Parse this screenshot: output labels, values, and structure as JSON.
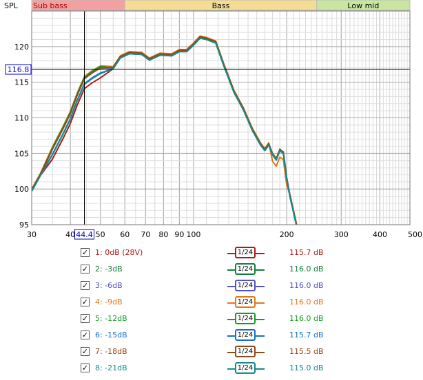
{
  "bands": [
    {
      "label": "Sub bass",
      "from": 30,
      "to": 60,
      "fill": "#f5a0a0",
      "text": "#b00000"
    },
    {
      "label": "Bass",
      "from": 60,
      "to": 250,
      "fill": "#f5dc94",
      "text": "#000000"
    },
    {
      "label": "Low mid",
      "from": 250,
      "to": 500,
      "fill": "#c8e6a0",
      "text": "#000000"
    }
  ],
  "cursor": {
    "x": 44.4,
    "y": 116.8,
    "x_label": "44.4",
    "y_label": "116.8"
  },
  "chart_data": {
    "type": "line",
    "ylabel": "SPL",
    "xunit": "Hz",
    "xscale": "log",
    "xlim": [
      30,
      500
    ],
    "ylim": [
      95,
      125
    ],
    "grid": true,
    "xticks": [
      {
        "v": 30,
        "label": "30"
      },
      {
        "v": 40,
        "label": "40"
      },
      {
        "v": 50,
        "label": "50"
      },
      {
        "v": 60,
        "label": "60"
      },
      {
        "v": 70,
        "label": "70"
      },
      {
        "v": 80,
        "label": "80"
      },
      {
        "v": 90,
        "label": "90"
      },
      {
        "v": 100,
        "label": "100"
      },
      {
        "v": 200,
        "label": "200"
      },
      {
        "v": 300,
        "label": "300"
      },
      {
        "v": 400,
        "label": "400"
      },
      {
        "v": 500,
        "label": "500Hz"
      }
    ],
    "yticks": [
      95,
      100,
      105,
      110,
      115,
      120
    ],
    "base_x": [
      30,
      32,
      35,
      38,
      40,
      42,
      44.4,
      47,
      50,
      55,
      58,
      62,
      68,
      72,
      78,
      85,
      90,
      95,
      100,
      105,
      110,
      118,
      125,
      135,
      145,
      155,
      165,
      170,
      175,
      180,
      185,
      190,
      195,
      200,
      205,
      215,
      230,
      240
    ],
    "base_y": [
      99.8,
      102,
      105.5,
      108.5,
      110.5,
      113,
      115.4,
      116.2,
      116.9,
      117,
      118.5,
      119.1,
      119,
      118.2,
      118.9,
      118.8,
      119.4,
      119.4,
      120.3,
      121.3,
      121.1,
      120.6,
      117.5,
      113.7,
      111.2,
      108.3,
      106.2,
      105.5,
      106.3,
      104.9,
      104.2,
      105.5,
      105.1,
      101.5,
      99,
      95,
      90,
      87
    ],
    "series": [
      {
        "name": "1: 0dB (28V)",
        "color": "#b01818",
        "spl": "115.7 dB",
        "dy": -0.1,
        "low": -1.2
      },
      {
        "name": "2: -3dB",
        "color": "#10803a",
        "spl": "116.0 dB",
        "dy": 0.0,
        "low": 0.2
      },
      {
        "name": "3: -6dB",
        "color": "#5050cc",
        "spl": "116.0 dB",
        "dy": 0.0,
        "low": 0.1
      },
      {
        "name": "4: -9dB",
        "color": "#e07818",
        "spl": "116.0 dB",
        "dy": 0.2,
        "low": 0.2
      },
      {
        "name": "5: -12dB",
        "color": "#10a020",
        "spl": "116.0 dB",
        "dy": 0.0,
        "low": 0.3
      },
      {
        "name": "6: -15dB",
        "color": "#1070d0",
        "spl": "115.7 dB",
        "dy": -0.1,
        "low": -0.5
      },
      {
        "name": "7: -18dB",
        "color": "#904818",
        "spl": "115.5 dB",
        "dy": 0.1,
        "low": 0.0
      },
      {
        "name": "8: -21dB",
        "color": "#148c8c",
        "spl": "115.0 dB",
        "dy": -0.1,
        "low": -0.6
      }
    ]
  },
  "legend": {
    "check_mark": "✓",
    "smoothing": "1/24"
  }
}
